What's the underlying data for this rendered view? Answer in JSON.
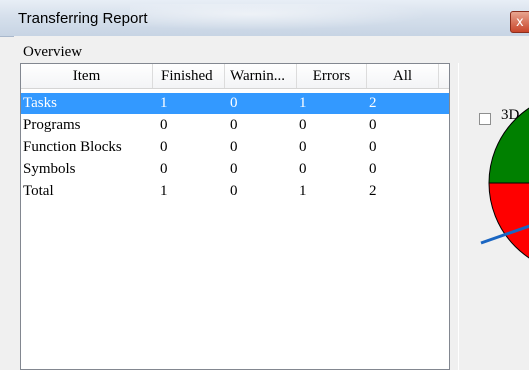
{
  "window": {
    "title": "Transferring Report",
    "close_glyph": "x"
  },
  "overview": {
    "label": "Overview",
    "columns": [
      "Item",
      "Finished",
      "Warnin...",
      "Errors",
      "All"
    ],
    "rows": [
      {
        "item": "Tasks",
        "finished": "1",
        "warnings": "0",
        "errors": "1",
        "all": "2",
        "selected": true
      },
      {
        "item": "Programs",
        "finished": "0",
        "warnings": "0",
        "errors": "0",
        "all": "0",
        "selected": false
      },
      {
        "item": "Function Blocks",
        "finished": "0",
        "warnings": "0",
        "errors": "0",
        "all": "0",
        "selected": false
      },
      {
        "item": "Symbols",
        "finished": "0",
        "warnings": "0",
        "errors": "0",
        "all": "0",
        "selected": false
      },
      {
        "item": "Total",
        "finished": "1",
        "warnings": "0",
        "errors": "1",
        "all": "2",
        "selected": false
      }
    ]
  },
  "chart_panel": {
    "checkbox_3d_label": "3D",
    "checkbox_3d_checked": false,
    "pie_colors": {
      "finished": "#008000",
      "errors": "#ff0000"
    }
  },
  "colors": {
    "selection": "#3399ff",
    "list_border": "#828790"
  }
}
